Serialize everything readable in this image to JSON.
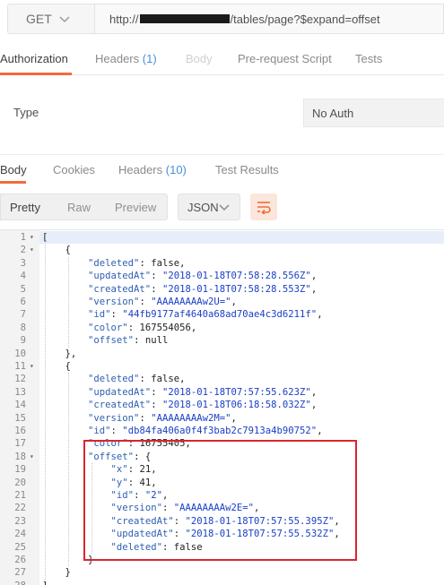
{
  "request": {
    "method": "GET",
    "url_prefix": "http://",
    "url_suffix": "/tables/page?$expand=offset"
  },
  "request_tabs": [
    {
      "label": "Authorization",
      "count": ""
    },
    {
      "label": "Headers",
      "count": "(1)"
    },
    {
      "label": "Body",
      "count": ""
    },
    {
      "label": "Pre-request Script",
      "count": ""
    },
    {
      "label": "Tests",
      "count": ""
    }
  ],
  "auth": {
    "type_label": "Type",
    "value": "No Auth"
  },
  "response_tabs": [
    {
      "label": "Body",
      "count": ""
    },
    {
      "label": "Cookies",
      "count": ""
    },
    {
      "label": "Headers",
      "count": "(10)"
    },
    {
      "label": "Test Results",
      "count": ""
    }
  ],
  "view_modes": [
    "Pretty",
    "Raw",
    "Preview"
  ],
  "format": "JSON",
  "icons": {
    "method_dropdown": "chevron-down-icon",
    "format_dropdown": "chevron-down-icon",
    "wrap": "wrap-lines-icon",
    "fold": "fold-arrow-icon"
  },
  "colors": {
    "accent": "#f26b3a",
    "highlight_box": "#d8262e",
    "json_key": "#2f5fb3",
    "count": "#4a8fd8"
  },
  "code_lines": [
    "[",
    "    {",
    "        \"deleted\": false,",
    "        \"updatedAt\": \"2018-01-18T07:58:28.556Z\",",
    "        \"createdAt\": \"2018-01-18T07:58:28.553Z\",",
    "        \"version\": \"AAAAAAAAw2U=\",",
    "        \"id\": \"44fb9177af4640a68ad70ae4c3d6211f\",",
    "        \"color\": 167554056,",
    "        \"offset\": null",
    "    },",
    "    {",
    "        \"deleted\": false,",
    "        \"updatedAt\": \"2018-01-18T07:57:55.623Z\",",
    "        \"createdAt\": \"2018-01-18T06:18:58.032Z\",",
    "        \"version\": \"AAAAAAAAw2M=\",",
    "        \"id\": \"db84fa406a0f4f3bab2c7913a4b90752\",",
    "        \"color\": 16755405,",
    "        \"offset\": {",
    "            \"x\": 21,",
    "            \"y\": 41,",
    "            \"id\": \"2\",",
    "            \"version\": \"AAAAAAAAw2E=\",",
    "            \"createdAt\": \"2018-01-18T07:57:55.395Z\",",
    "            \"updatedAt\": \"2018-01-18T07:57:55.532Z\",",
    "            \"deleted\": false",
    "        }",
    "    }",
    "]"
  ],
  "foldable_lines": [
    1,
    2,
    11,
    18
  ]
}
